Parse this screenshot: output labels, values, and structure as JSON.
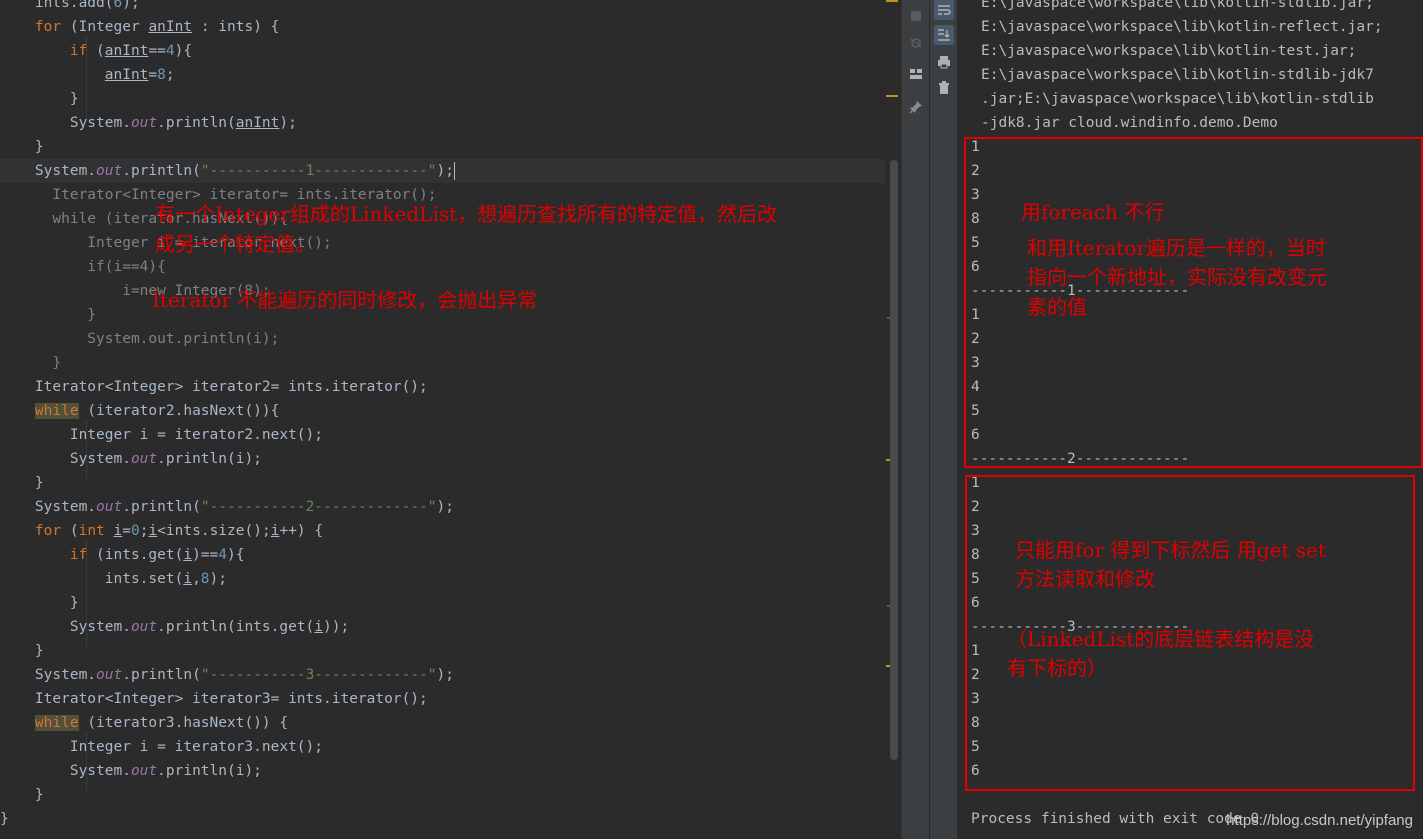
{
  "editor": {
    "lines": [
      "    ints.add(6);",
      "    for (Integer anInt : ints) {",
      "        if (anInt==4){",
      "            anInt=8;",
      "        }",
      "        System.out.println(anInt);",
      "    }",
      "    System.out.println(\"-----------1-------------\");",
      "      Iterator<Integer> iterator= ints.iterator();",
      "      while (iterator.hasNext()){",
      "          Integer i = iterator.next();",
      "          if(i==4){",
      "              i=new Integer(8);",
      "          }",
      "          System.out.println(i);",
      "      }",
      "    Iterator<Integer> iterator2= ints.iterator();",
      "    while (iterator2.hasNext()){",
      "        Integer i = iterator2.next();",
      "        System.out.println(i);",
      "    }",
      "    System.out.println(\"-----------2-------------\");",
      "    for (int i=0;i<ints.size();i++) {",
      "        if (ints.get(i)==4){",
      "            ints.set(i,8);",
      "        }",
      "        System.out.println(ints.get(i));",
      "    }",
      "    System.out.println(\"-----------3-------------\");",
      "    Iterator<Integer> iterator3= ints.iterator();",
      "    while (iterator3.hasNext()) {",
      "        Integer i = iterator3.next();",
      "        System.out.println(i);",
      "    }",
      "}"
    ],
    "notes": {
      "note1_line1": "有一个Integer组成的LinkedList，想遍历查找所有的特定值，然后改",
      "note1_line2": "成另一个特定值。",
      "note2": "Iterator 不能遍历的同时修改，会抛出异常"
    }
  },
  "console": {
    "classpath_lines": [
      "E:\\javaspace\\workspace\\lib\\kotlin-stdlib.jar;",
      "E:\\javaspace\\workspace\\lib\\kotlin-reflect.jar;",
      "E:\\javaspace\\workspace\\lib\\kotlin-test.jar;",
      "E:\\javaspace\\workspace\\lib\\kotlin-stdlib-jdk7",
      ".jar;E:\\javaspace\\workspace\\lib\\kotlin-stdlib",
      "-jdk8.jar cloud.windinfo.demo.Demo"
    ],
    "output_lines": [
      "1",
      "2",
      "3",
      "8",
      "5",
      "6",
      "-----------1-------------",
      "1",
      "2",
      "3",
      "4",
      "5",
      "6",
      "-----------2-------------",
      "1",
      "2",
      "3",
      "8",
      "5",
      "6",
      "-----------3-------------",
      "1",
      "2",
      "3",
      "8",
      "5",
      "6"
    ],
    "process_finished": "Process finished with exit code 0",
    "notes": {
      "box1_title": "用foreach 不行",
      "box1_line1": "和用Iterator遍历是一样的，当时",
      "box1_line2": "指向一个新地址，实际没有改变元",
      "box1_line3": "素的值",
      "box2_line1": "只能用for 得到下标然后 用get set",
      "box2_line2": "方法读取和修改",
      "box2_line3": "（LinkedList的底层链表结构是没",
      "box2_line4": "有下标的）"
    },
    "watermark": "https://blog.csdn.net/yipfang"
  },
  "toolbar_icons": [
    "stop-icon",
    "debug-icon",
    "layout-icon",
    "pin-icon",
    "soft-wrap-icon",
    "scroll-to-end-icon",
    "print-icon",
    "trash-icon"
  ],
  "colors": {
    "editor_bg": "#2b2b2b",
    "keyword": "#cc7832",
    "number": "#6897bb",
    "string": "#6a8759",
    "field": "#9876aa",
    "annotation_red": "#e00000"
  }
}
